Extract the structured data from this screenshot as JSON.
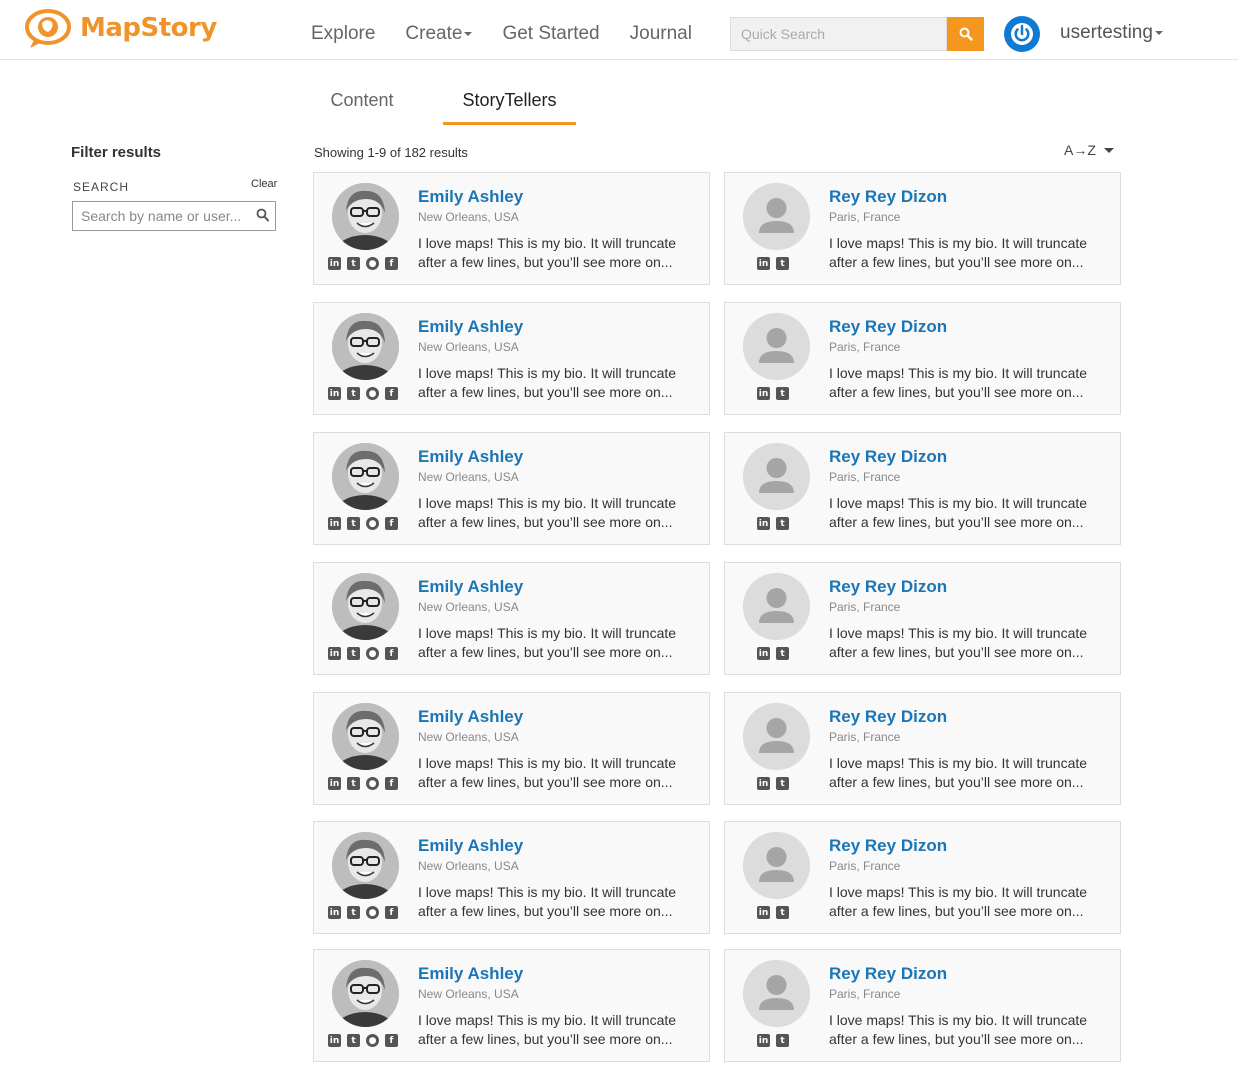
{
  "header": {
    "logo_text": "MapStory",
    "nav": [
      {
        "label": "Explore",
        "dropdown": false
      },
      {
        "label": "Create",
        "dropdown": true
      },
      {
        "label": "Get Started",
        "dropdown": false
      },
      {
        "label": "Journal",
        "dropdown": false
      }
    ],
    "search_placeholder": "Quick Search",
    "username": "usertesting",
    "accent_color": "#f5961e",
    "power_icon_color": "#0f7ad1"
  },
  "tabs": [
    {
      "label": "Content",
      "active": false
    },
    {
      "label": "StoryTellers",
      "active": true
    }
  ],
  "sidebar": {
    "title": "Filter results",
    "search_label": "SEARCH",
    "clear_label": "Clear",
    "search_placeholder": "Search by name or user..."
  },
  "results": {
    "showing": "Showing 1-9 of 182 results",
    "sort_label": "A→Z"
  },
  "cards": [
    {
      "name": "Emily Ashley",
      "location": "New Orleans, USA",
      "bio": "I love maps! This is my bio. It will truncate after a few lines, but you’ll see more on...",
      "avatar": "photo",
      "socials": [
        "linkedin",
        "twitter",
        "github",
        "facebook"
      ]
    },
    {
      "name": "Rey Rey Dizon",
      "location": "Paris, France",
      "bio": "I love maps! This is my bio. It will truncate after a few lines, but you’ll see more on...",
      "avatar": "placeholder",
      "socials": [
        "linkedin",
        "twitter"
      ]
    },
    {
      "name": "Emily Ashley",
      "location": "New Orleans, USA",
      "bio": "I love maps! This is my bio. It will truncate after a few lines, but you’ll see more on...",
      "avatar": "photo",
      "socials": [
        "linkedin",
        "twitter",
        "github",
        "facebook"
      ]
    },
    {
      "name": "Rey Rey Dizon",
      "location": "Paris, France",
      "bio": "I love maps! This is my bio. It will truncate after a few lines, but you’ll see more on...",
      "avatar": "placeholder",
      "socials": [
        "linkedin",
        "twitter"
      ]
    },
    {
      "name": "Emily Ashley",
      "location": "New Orleans, USA",
      "bio": "I love maps! This is my bio. It will truncate after a few lines, but you’ll see more on...",
      "avatar": "photo",
      "socials": [
        "linkedin",
        "twitter",
        "github",
        "facebook"
      ]
    },
    {
      "name": "Rey Rey Dizon",
      "location": "Paris, France",
      "bio": "I love maps! This is my bio. It will truncate after a few lines, but you’ll see more on...",
      "avatar": "placeholder",
      "socials": [
        "linkedin",
        "twitter"
      ]
    },
    {
      "name": "Emily Ashley",
      "location": "New Orleans, USA",
      "bio": "I love maps! This is my bio. It will truncate after a few lines, but you’ll see more on...",
      "avatar": "photo",
      "socials": [
        "linkedin",
        "twitter",
        "github",
        "facebook"
      ]
    },
    {
      "name": "Rey Rey Dizon",
      "location": "Paris, France",
      "bio": "I love maps! This is my bio. It will truncate after a few lines, but you’ll see more on...",
      "avatar": "placeholder",
      "socials": [
        "linkedin",
        "twitter"
      ]
    },
    {
      "name": "Emily Ashley",
      "location": "New Orleans, USA",
      "bio": "I love maps! This is my bio. It will truncate after a few lines, but you’ll see more on...",
      "avatar": "photo",
      "socials": [
        "linkedin",
        "twitter",
        "github",
        "facebook"
      ]
    },
    {
      "name": "Rey Rey Dizon",
      "location": "Paris, France",
      "bio": "I love maps! This is my bio. It will truncate after a few lines, but you’ll see more on...",
      "avatar": "placeholder",
      "socials": [
        "linkedin",
        "twitter"
      ]
    },
    {
      "name": "Emily Ashley",
      "location": "New Orleans, USA",
      "bio": "I love maps! This is my bio. It will truncate after a few lines, but you’ll see more on...",
      "avatar": "photo",
      "socials": [
        "linkedin",
        "twitter",
        "github",
        "facebook"
      ]
    },
    {
      "name": "Rey Rey Dizon",
      "location": "Paris, France",
      "bio": "I love maps! This is my bio. It will truncate after a few lines, but you’ll see more on...",
      "avatar": "placeholder",
      "socials": [
        "linkedin",
        "twitter"
      ]
    },
    {
      "name": "Emily Ashley",
      "location": "New Orleans, USA",
      "bio": "I love maps! This is my bio. It will truncate after a few lines, but you’ll see more on...",
      "avatar": "photo",
      "socials": [
        "linkedin",
        "twitter",
        "github",
        "facebook"
      ]
    },
    {
      "name": "Rey Rey Dizon",
      "location": "Paris, France",
      "bio": "I love maps! This is my bio. It will truncate after a few lines, but you’ll see more on...",
      "avatar": "placeholder",
      "socials": [
        "linkedin",
        "twitter"
      ]
    }
  ]
}
